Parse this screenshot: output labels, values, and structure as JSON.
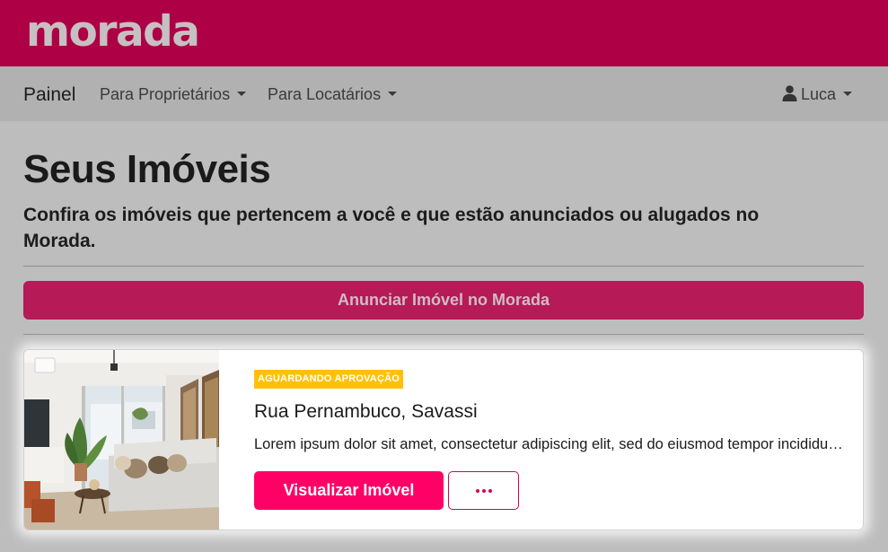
{
  "brand": {
    "logo_text": "morada"
  },
  "navbar": {
    "brand_label": "Painel",
    "items": [
      {
        "label": "Para Proprietários"
      },
      {
        "label": "Para Locatários"
      }
    ],
    "user": {
      "label": "Luca",
      "icon": "user-icon"
    }
  },
  "page": {
    "title": "Seus Imóveis",
    "subtitle": "Confira os imóveis que pertencem a você e que estão anunciados ou alugados no Morada.",
    "cta_label": "Anunciar Imóvel no Morada"
  },
  "property": {
    "status_badge": "AGUARDANDO APROVAÇÃO",
    "title": "Rua Pernambuco, Savassi",
    "description": "Lorem ipsum dolor sit amet, consectetur adipiscing elit, sed do eiusmod tempor incididunt ut labore",
    "primary_action": "Visualizar Imóvel",
    "more_icon": "ellipsis-icon"
  },
  "colors": {
    "brand": "#ad0045",
    "primary_button": "#ff0066",
    "badge": "#ffc107"
  }
}
